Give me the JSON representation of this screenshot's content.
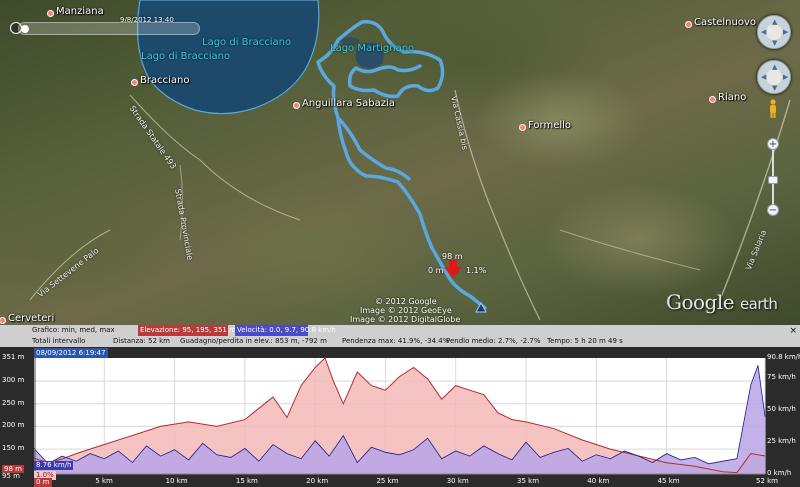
{
  "map": {
    "places": [
      {
        "name": "Manziana",
        "style": ""
      },
      {
        "name": "Bracciano",
        "style": ""
      },
      {
        "name": "Anguillara Sabazia",
        "style": ""
      },
      {
        "name": "Formello",
        "style": ""
      },
      {
        "name": "Castelnuovo",
        "style": ""
      },
      {
        "name": "Riano",
        "style": ""
      },
      {
        "name": "Cerveteri",
        "style": ""
      }
    ],
    "lakes": [
      "Lago di Bracciano",
      "Lago di Bracciano",
      "Lago Martignano"
    ],
    "roads": [
      "Strada Statale 493",
      "Via Settevene Palo",
      "Strada Provinciale",
      "Via Cassia bis",
      "Via Salaria"
    ],
    "time_label": "9/8/2012 13:40",
    "track_labels": {
      "elev": "98 m",
      "left": "0 m",
      "right": "1.1%"
    },
    "copyright": [
      "© 2012 Google",
      "Image © 2012 GeoEye",
      "Image © 2012 DigitalGlobe"
    ],
    "logo_brand": "Google",
    "logo_product": "earth",
    "colors": {
      "track": "#5aa8e0",
      "lake": "#1d4a6a",
      "cursor_arrow": "#e21818"
    },
    "icons": [
      "clock-icon",
      "compass-icon",
      "look-icon",
      "pegman-icon",
      "zoom-in-icon",
      "zoom-out-icon",
      "down-arrow-icon",
      "track-end-icon"
    ]
  },
  "stats": {
    "graph_label": "Grafico: min, med, max",
    "elevation": "Elevazione: 95, 195, 351 m",
    "velocity": "Velocità: 0.0, 9.7, 90.8 km/h",
    "total_label": "Totali intervallo",
    "distance": "Distanza: 52 km",
    "gain_loss": "Guadagno/perdita in elev.: 853 m, -792 m",
    "slope_max": "Pendenza max: 41.9%, -34.4%",
    "slope_avg": "Pendio medio: 2.7%, -2.7%",
    "time": "Tempo: 5 h 20 m 49 s",
    "close": "×"
  },
  "chart_data": {
    "type": "area",
    "date_tag": "08/09/2012 6:19:47",
    "xlabel": "",
    "ylabel": "",
    "x_ticks": [
      "5 km",
      "10 km",
      "15 km",
      "20 km",
      "25 km",
      "30 km",
      "35 km",
      "40 km",
      "45 km",
      "52 km"
    ],
    "y_left_ticks": [
      "351 m",
      "300 m",
      "250 m",
      "200 m",
      "150 m",
      "98 m",
      "95 m"
    ],
    "y_right_ticks": [
      "90.8 km/h",
      "75 km/h",
      "50 km/h",
      "25 km/h",
      "0 km/h"
    ],
    "start_badge": "0 m",
    "speed_badge": "8.76 km/h",
    "slope_badge": "1.0%",
    "xlim": [
      0,
      52
    ],
    "ylim_elev": [
      95,
      351
    ],
    "ylim_speed": [
      0,
      90.8
    ],
    "series": [
      {
        "name": "Elevazione",
        "color": "#b52c2c",
        "fill": "#f4b8b8",
        "x": [
          0,
          1,
          2,
          3,
          5,
          7,
          9,
          11,
          13,
          15,
          16,
          17,
          18,
          19,
          20,
          20.7,
          21.3,
          22,
          23,
          24,
          25,
          26,
          27,
          28,
          29,
          30,
          31,
          32,
          33,
          34,
          35,
          37,
          39,
          41,
          43,
          45,
          47,
          49,
          50,
          51,
          52
        ],
        "values": [
          130,
          120,
          128,
          140,
          160,
          180,
          200,
          210,
          200,
          215,
          240,
          265,
          220,
          290,
          330,
          351,
          300,
          250,
          320,
          290,
          280,
          310,
          330,
          305,
          260,
          290,
          280,
          270,
          230,
          215,
          210,
          195,
          170,
          150,
          135,
          120,
          112,
          100,
          98,
          140,
          135
        ]
      },
      {
        "name": "Velocità",
        "color": "#1a1a8a",
        "fill": "#b9a4e6",
        "x": [
          0,
          1,
          2,
          3,
          4,
          5,
          6,
          7,
          8,
          9,
          10,
          11,
          12,
          13,
          14,
          15,
          16,
          17,
          18,
          19,
          20,
          21,
          22,
          23,
          24,
          25,
          26,
          27,
          28,
          29,
          30,
          31,
          32,
          33,
          34,
          35,
          36,
          37,
          38,
          39,
          40,
          41,
          42,
          43,
          44,
          45,
          46,
          47,
          48,
          49,
          50,
          51,
          51.5,
          52
        ],
        "values": [
          20,
          8,
          14,
          10,
          16,
          12,
          18,
          9,
          22,
          14,
          19,
          11,
          24,
          15,
          13,
          20,
          10,
          23,
          16,
          12,
          26,
          14,
          30,
          9,
          21,
          17,
          15,
          19,
          28,
          12,
          18,
          14,
          22,
          16,
          11,
          25,
          13,
          17,
          20,
          10,
          15,
          12,
          18,
          14,
          9,
          16,
          11,
          13,
          8,
          10,
          12,
          70,
          85,
          45
        ]
      }
    ]
  }
}
